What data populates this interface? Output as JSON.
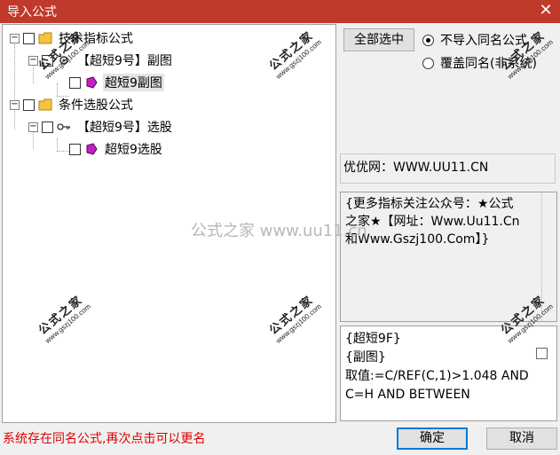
{
  "window": {
    "title": "导入公式",
    "close_glyph": "✕"
  },
  "tree": {
    "nodes": [
      {
        "expander": "−",
        "label": "技术指标公式",
        "icon": "folder-icon"
      },
      {
        "expander": "−",
        "label": "【超短9号】副图",
        "icon": "gear-icon"
      },
      {
        "expander": "",
        "label": "超短9副图",
        "icon": "formula-gem-icon"
      },
      {
        "expander": "−",
        "label": "条件选股公式",
        "icon": "folder-icon"
      },
      {
        "expander": "−",
        "label": "【超短9号】选股",
        "icon": "key-icon"
      },
      {
        "expander": "",
        "label": "超短9选股",
        "icon": "formula-gem-icon"
      }
    ]
  },
  "buttons": {
    "select_all": "全部选中",
    "ok": "确定",
    "cancel": "取消"
  },
  "radios": [
    {
      "label": "不导入同名公式",
      "checked": true
    },
    {
      "label": "覆盖同名(非系统)",
      "checked": false
    }
  ],
  "site_text": "优优网：WWW.UU11.CN",
  "info_lines": [
    "{更多指标关注公众号：★公式",
    "之家★【网址：Www.Uu11.Cn",
    "和Www.Gszj100.Com】}"
  ],
  "formula_lines": [
    "{超短9F}",
    "{副图}",
    "取值:=C/REF(C,1)>1.048 AND",
    "C=H AND BETWEEN"
  ],
  "status_text": "系统存在同名公式,再次点击可以更名",
  "watermark": {
    "text": "公式之家",
    "url": "www.gszj100.com",
    "center": "公式之家 www.uu11.cn"
  },
  "colors": {
    "titlebar": "#c0392b",
    "status": "#e00000",
    "ok_border": "#0078d7"
  }
}
